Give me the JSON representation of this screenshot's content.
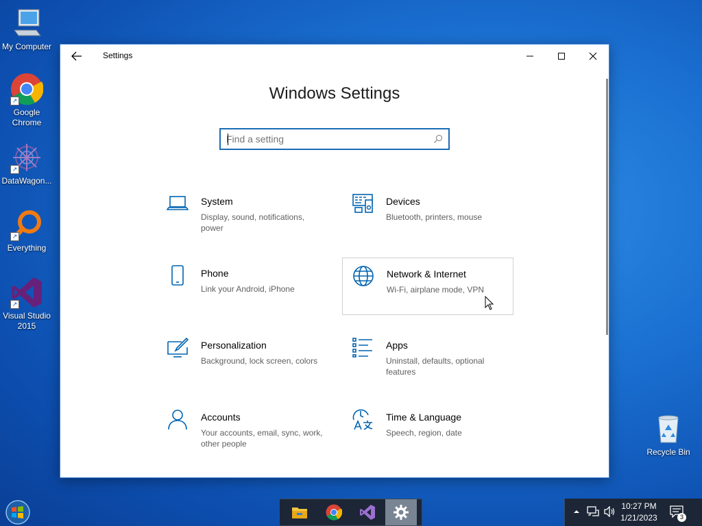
{
  "desktop": {
    "icons": [
      {
        "label": "My Computer",
        "icon": "computer-icon"
      },
      {
        "label": "Google Chrome",
        "icon": "chrome-icon"
      },
      {
        "label": "DataWagon...",
        "icon": "datawagon-icon"
      },
      {
        "label": "Everything",
        "icon": "everything-search-icon"
      },
      {
        "label": "Visual Studio 2015",
        "icon": "visual-studio-icon"
      },
      {
        "label": "Recycle Bin",
        "icon": "recycle-bin-icon"
      }
    ]
  },
  "window": {
    "title": "Settings",
    "heading": "Windows Settings",
    "search": {
      "placeholder": "Find a setting",
      "value": ""
    },
    "tiles": [
      {
        "name": "System",
        "desc": "Display, sound, notifications, power",
        "icon": "laptop-icon"
      },
      {
        "name": "Devices",
        "desc": "Bluetooth, printers, mouse",
        "icon": "devices-icon"
      },
      {
        "name": "Phone",
        "desc": "Link your Android, iPhone",
        "icon": "phone-icon"
      },
      {
        "name": "Network & Internet",
        "desc": "Wi-Fi, airplane mode, VPN",
        "icon": "globe-icon"
      },
      {
        "name": "Personalization",
        "desc": "Background, lock screen, colors",
        "icon": "personalization-icon"
      },
      {
        "name": "Apps",
        "desc": "Uninstall, defaults, optional features",
        "icon": "apps-list-icon"
      },
      {
        "name": "Accounts",
        "desc": "Your accounts, email, sync, work, other people",
        "icon": "person-icon"
      },
      {
        "name": "Time & Language",
        "desc": "Speech, region, date",
        "icon": "time-language-icon"
      }
    ],
    "hovered_tile": "Network & Internet"
  },
  "taskbar": {
    "apps": [
      "File Explorer",
      "Google Chrome",
      "Visual Studio",
      "Settings"
    ],
    "active_app": "Settings",
    "clock": {
      "time": "10:27 PM",
      "date": "1/21/2023"
    },
    "notification_count": "3"
  },
  "colors": {
    "accent": "#1a6bb5",
    "icon_blue": "#0063b1"
  }
}
